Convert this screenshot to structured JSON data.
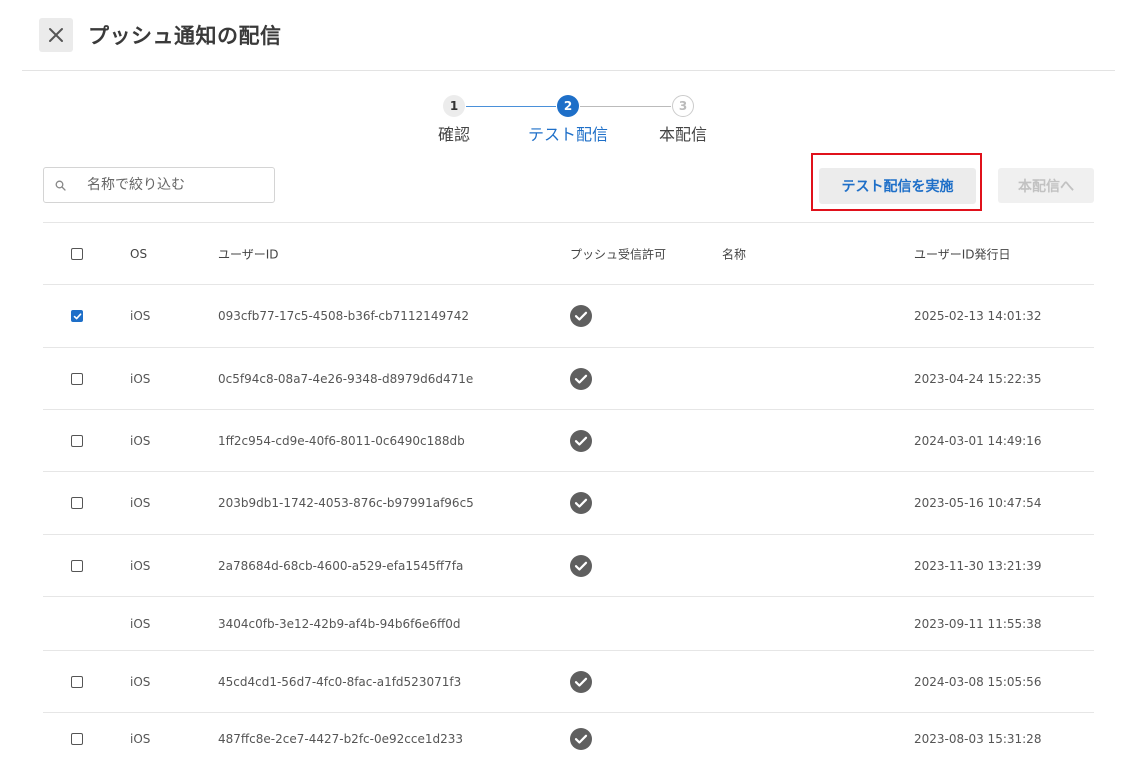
{
  "header": {
    "title": "プッシュ通知の配信"
  },
  "stepper": {
    "steps": [
      {
        "number": "1",
        "label": "確認"
      },
      {
        "number": "2",
        "label": "テスト配信"
      },
      {
        "number": "3",
        "label": "本配信"
      }
    ],
    "current": 2
  },
  "search": {
    "placeholder": "名称で絞り込む",
    "value": ""
  },
  "actions": {
    "test_send_label": "テスト配信を実施",
    "main_send_label": "本配信へ"
  },
  "table": {
    "columns": {
      "os": "OS",
      "user_id": "ユーザーID",
      "push_permission": "プッシュ受信許可",
      "name": "名称",
      "issued_date": "ユーザーID発行日"
    },
    "rows": [
      {
        "checkbox": "checked",
        "os": "iOS",
        "user_id": "093cfb77-17c5-4508-b36f-cb7112149742",
        "push_permission": true,
        "name": "",
        "issued_date": "2025-02-13 14:01:32"
      },
      {
        "checkbox": "unchecked",
        "os": "iOS",
        "user_id": "0c5f94c8-08a7-4e26-9348-d8979d6d471e",
        "push_permission": true,
        "name": "",
        "issued_date": "2023-04-24 15:22:35"
      },
      {
        "checkbox": "unchecked",
        "os": "iOS",
        "user_id": "1ff2c954-cd9e-40f6-8011-0c6490c188db",
        "push_permission": true,
        "name": "",
        "issued_date": "2024-03-01 14:49:16"
      },
      {
        "checkbox": "unchecked",
        "os": "iOS",
        "user_id": "203b9db1-1742-4053-876c-b97991af96c5",
        "push_permission": true,
        "name": "",
        "issued_date": "2023-05-16 10:47:54"
      },
      {
        "checkbox": "unchecked",
        "os": "iOS",
        "user_id": "2a78684d-68cb-4600-a529-efa1545ff7fa",
        "push_permission": true,
        "name": "",
        "issued_date": "2023-11-30 13:21:39"
      },
      {
        "checkbox": "none",
        "os": "iOS",
        "user_id": "3404c0fb-3e12-42b9-af4b-94b6f6e6ff0d",
        "push_permission": false,
        "name": "",
        "issued_date": "2023-09-11 11:55:38"
      },
      {
        "checkbox": "unchecked",
        "os": "iOS",
        "user_id": "45cd4cd1-56d7-4fc0-8fac-a1fd523071f3",
        "push_permission": true,
        "name": "",
        "issued_date": "2024-03-08 15:05:56"
      },
      {
        "checkbox": "unchecked",
        "os": "iOS",
        "user_id": "487ffc8e-2ce7-4427-b2fc-0e92cce1d233",
        "push_permission": true,
        "name": "",
        "issued_date": "2023-08-03 15:31:28"
      }
    ]
  },
  "colors": {
    "accent": "#1e6fc8",
    "highlight_frame": "#e0111b",
    "check_badge": "#5f5f5f",
    "divider": "#e6e6e6"
  },
  "icons": {
    "close": "close-icon",
    "search": "search-icon",
    "push_allowed": "check-circle-icon"
  }
}
